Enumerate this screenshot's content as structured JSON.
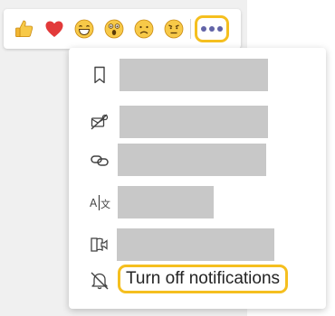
{
  "reactions": [
    {
      "icon": "thumbs-up-icon"
    },
    {
      "icon": "heart-icon"
    },
    {
      "icon": "laughing-face-icon"
    },
    {
      "icon": "surprised-face-icon"
    },
    {
      "icon": "sad-face-icon"
    },
    {
      "icon": "angry-face-icon"
    }
  ],
  "more_options": {
    "icon": "more-options-icon"
  },
  "menu": {
    "items": [
      {
        "icon": "bookmark-icon"
      },
      {
        "icon": "mark-unread-icon"
      },
      {
        "icon": "link-icon"
      },
      {
        "icon": "translate-icon"
      },
      {
        "icon": "immersive-reader-icon"
      },
      {
        "icon": "bell-off-icon",
        "label": "Turn off notifications"
      }
    ]
  },
  "colors": {
    "highlight": "#f5bf1f",
    "accent": "#6264a7",
    "placeholder": "#c8c8c8"
  }
}
